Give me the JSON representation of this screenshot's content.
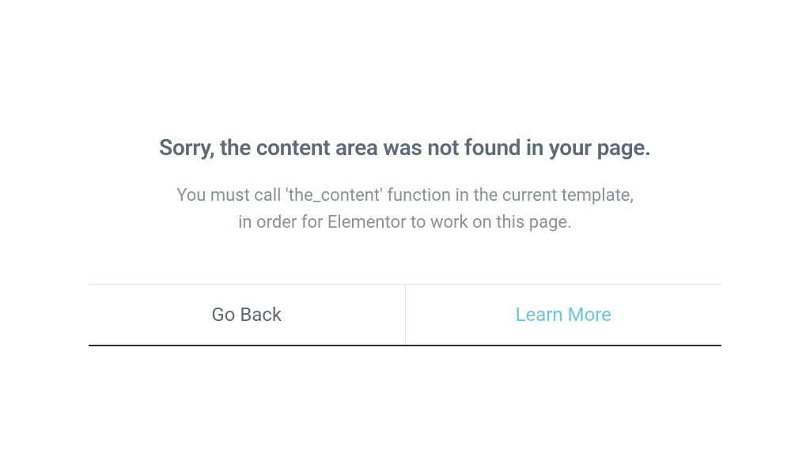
{
  "dialog": {
    "title": "Sorry, the content area was not found in your page.",
    "description_line1": "You must call 'the_content' function in the current template,",
    "description_line2": "in order for Elementor to work on this page.",
    "buttons": {
      "back": "Go Back",
      "learn_more": "Learn More"
    }
  },
  "colors": {
    "title": "#5f6a75",
    "description": "#8a929a",
    "accent": "#6bc7e0",
    "divider": "#e4e6e8",
    "bottom_border": "#2b2f33"
  }
}
